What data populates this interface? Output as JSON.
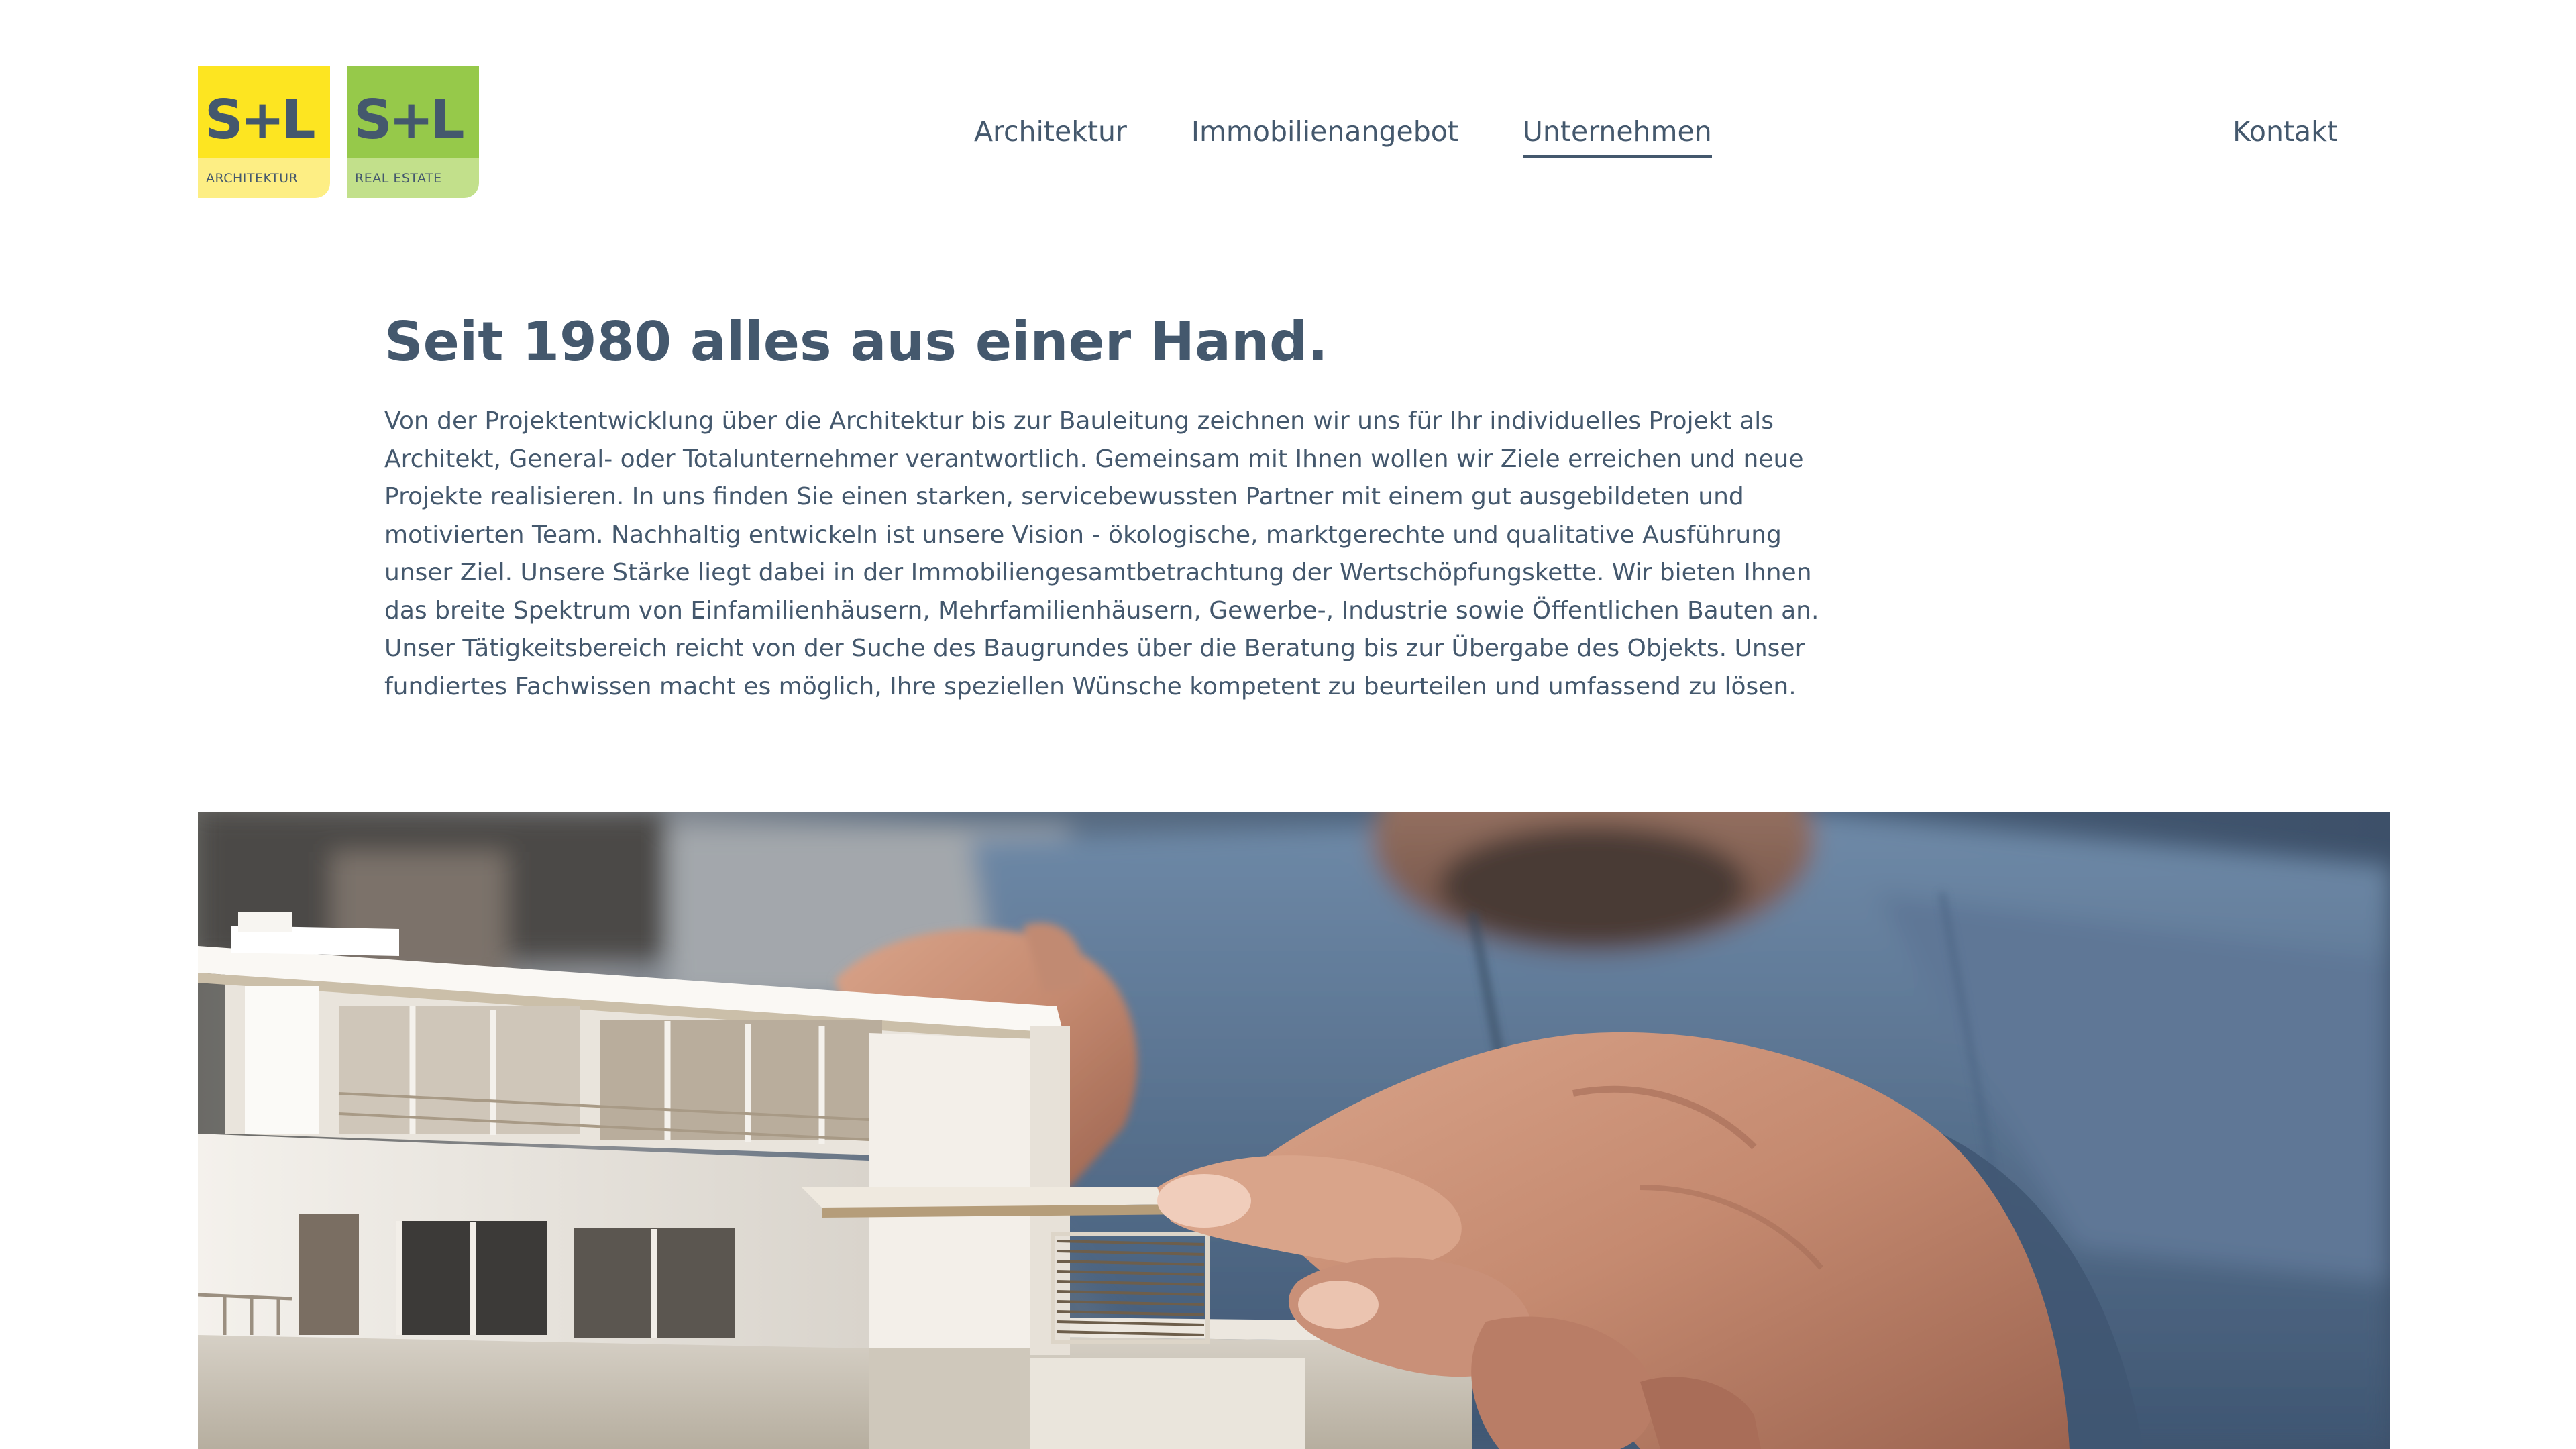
{
  "header": {
    "logos": [
      {
        "mark": "S+L",
        "subtitle": "ARCHITEKTUR"
      },
      {
        "mark": "S+L",
        "subtitle": "REAL ESTATE"
      }
    ],
    "nav": [
      {
        "label": "Architektur",
        "active": false
      },
      {
        "label": "Immobilienangebot",
        "active": false
      },
      {
        "label": "Unternehmen",
        "active": true
      }
    ],
    "contact_label": "Kontakt"
  },
  "main": {
    "headline": "Seit 1980 alles aus einer Hand.",
    "body": "Von der Projektentwicklung über die Architektur bis zur Bauleitung zeichnen wir uns für Ihr individuelles Projekt als Architekt, General- oder Totalunternehmer verantwortlich. Gemeinsam mit Ihnen wollen wir Ziele erreichen und neue Projekte realisieren. In uns finden Sie einen starken, servicebewussten Partner mit einem gut ausgebildeten und motivierten Team. Nachhaltig entwickeln ist unsere Vision - ökologische, marktgerechte und qualitative Ausführung unser Ziel. Unsere Stärke liegt dabei in der Immobiliengesamtbetrachtung der Wertschöpfungskette. Wir bieten Ihnen das breite Spektrum von Einfamilienhäusern, Mehrfamilienhäusern, Gewerbe-, Industrie sowie Öffentlichen Bauten an. Unser Tätigkeitsbereich reicht von der Suche des Baugrundes über die Beratung bis zur Übergabe des Objekts. Unser fundiertes Fachwissen macht es möglich, Ihre speziellen Wünsche kompetent zu beurteilen und umfassend zu lösen."
  },
  "colors": {
    "text": "#44586d",
    "logo_architektur": "#fde521",
    "logo_architektur_light": "#fdee84",
    "logo_real_estate": "#96c94a",
    "logo_real_estate_light": "#c2e08b"
  }
}
